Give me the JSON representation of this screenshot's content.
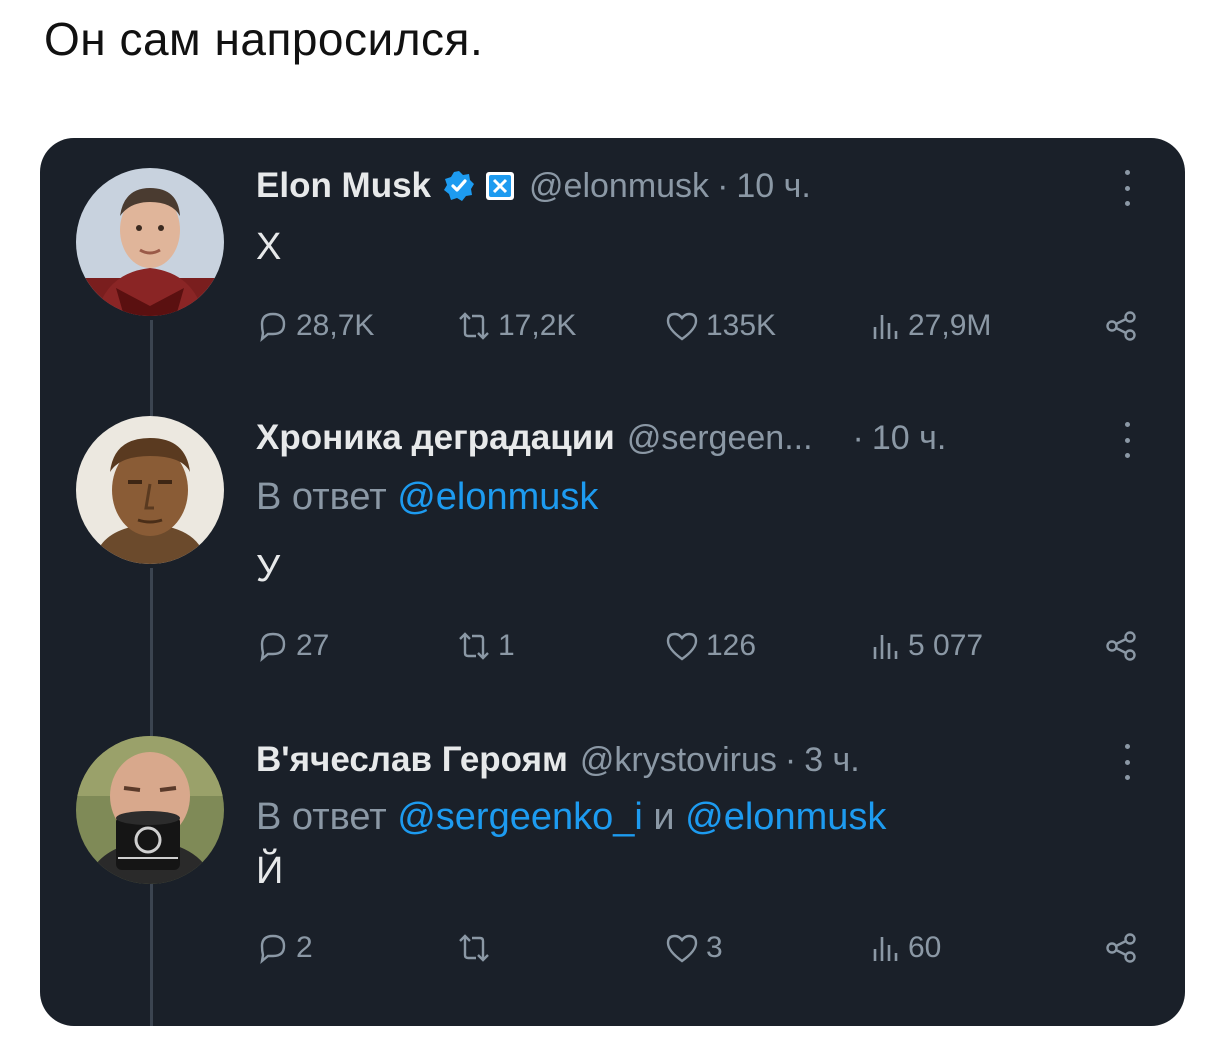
{
  "caption": "Он сам напросился.",
  "colors": {
    "card_bg": "#1a2029",
    "text_primary": "#e7e9ea",
    "text_secondary": "#8b98a5",
    "mention": "#1d9bf0",
    "verified": "#1d9bf0"
  },
  "tweets": [
    {
      "name": "Elon Musk",
      "handle": "@elonmusk",
      "time": "10 ч.",
      "verified": true,
      "reply_prefix": "",
      "mention1": "",
      "mention_joiner": "",
      "mention2": "",
      "text": "Х",
      "replies": "28,7K",
      "reposts": "17,2K",
      "likes": "135K",
      "views": "27,9M",
      "icons": [
        "reply-icon",
        "repost-icon",
        "like-icon",
        "views-icon",
        "share-icon"
      ]
    },
    {
      "name": "Хроника деградации",
      "handle": "@sergeen...",
      "time": "10 ч.",
      "verified": false,
      "reply_prefix": "В ответ ",
      "mention1": "@elonmusk",
      "mention_joiner": "",
      "mention2": "",
      "text": "У",
      "replies": "27",
      "reposts": "1",
      "likes": "126",
      "views": "5 077"
    },
    {
      "name": "В'ячеслав Героям",
      "handle": "@krystovirus",
      "time": "3 ч.",
      "verified": false,
      "reply_prefix": "В ответ ",
      "mention1": "@sergeenko_i",
      "mention_joiner": " и ",
      "mention2": "@elonmusk",
      "text": "Й",
      "replies": "2",
      "reposts": "",
      "likes": "3",
      "views": "60"
    }
  ]
}
